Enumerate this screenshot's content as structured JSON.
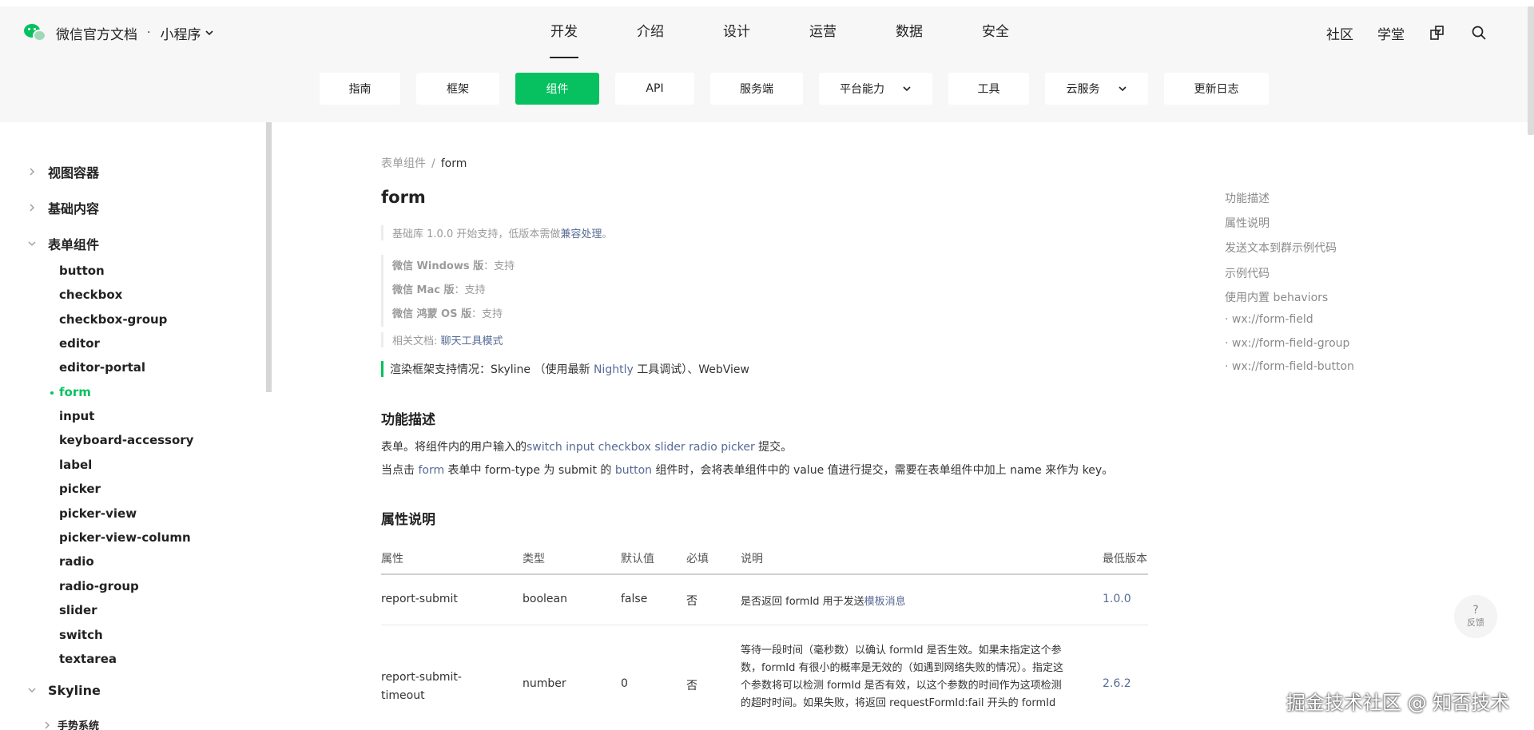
{
  "header": {
    "brand_title": "微信官方文档",
    "brand_separator": "·",
    "brand_sub": "小程序",
    "nav": [
      "开发",
      "介绍",
      "设计",
      "运营",
      "数据",
      "安全"
    ],
    "active_nav": "开发",
    "right_links": [
      "社区",
      "学堂"
    ]
  },
  "subnav": {
    "items": [
      "指南",
      "框架",
      "组件",
      "API",
      "服务端",
      "平台能力",
      "工具",
      "云服务",
      "更新日志"
    ],
    "active": "组件"
  },
  "sidebar": {
    "groups": [
      "视图容器",
      "基础内容",
      "表单组件",
      "Skyline"
    ],
    "items": [
      "button",
      "checkbox",
      "checkbox-group",
      "editor",
      "editor-portal",
      "form",
      "input",
      "keyboard-accessory",
      "label",
      "picker",
      "picker-view",
      "picker-view-column",
      "radio",
      "radio-group",
      "slider",
      "switch",
      "textarea"
    ],
    "active_item": "form",
    "sub_group": "手势系统"
  },
  "main": {
    "breadcrumb": {
      "parent": "表单组件",
      "sep": "/",
      "current": "form"
    },
    "title": "form",
    "support": {
      "prefix": "基础库 1.0.0 开始支持，低版本需做",
      "link": "兼容处理",
      "suffix": "。"
    },
    "platforms": [
      {
        "label": "微信 Windows 版",
        "value": "：支持"
      },
      {
        "label": "微信 Mac 版",
        "value": "：支持"
      },
      {
        "label": "微信 鸿蒙 OS 版",
        "value": "：支持"
      }
    ],
    "related": {
      "prefix": "相关文档: ",
      "link": "聊天工具模式"
    },
    "render": {
      "prefix": "渲染框架支持情况：Skyline （使用最新 ",
      "link": "Nightly",
      "suffix": " 工具调试）、WebView"
    },
    "section1": {
      "title": "功能描述",
      "p1_prefix": "表单。将组件内的用户输入的",
      "p1_link": "switch input checkbox slider radio picker",
      "p1_suffix": " 提交。",
      "p2_a": "当点击 ",
      "p2_link1": "form",
      "p2_b": " 表单中 form-type 为 submit 的 ",
      "p2_link2": "button",
      "p2_c": " 组件时，会将表单组件中的 value 值进行提交，需要在表单组件中加上 name 来作为 key。"
    },
    "section2": {
      "title": "属性说明"
    },
    "table": {
      "headers": [
        "属性",
        "类型",
        "默认值",
        "必填",
        "说明",
        "最低版本"
      ],
      "rows": [
        {
          "name": "report-submit",
          "type": "boolean",
          "default": "false",
          "required": "否",
          "desc_prefix": "是否返回 formId 用于发送",
          "desc_link": "模板消息",
          "version": "1.0.0"
        },
        {
          "name": "report-submit-timeout",
          "type": "number",
          "default": "0",
          "required": "否",
          "desc": "等待一段时间（毫秒数）以确认 formId 是否生效。如果未指定这个参数，formId 有很小的概率是无效的（如遇到网络失败的情况）。指定这个参数将可以检测 formId 是否有效，以这个参数的时间作为这项检测的超时时间。如果失败，将返回 requestFormId:fail 开头的 formId",
          "version": "2.6.2"
        }
      ]
    }
  },
  "toc": [
    "功能描述",
    "属性说明",
    "发送文本到群示例代码",
    "示例代码",
    "使用内置 behaviors",
    "· wx://form-field",
    "· wx://form-field-group",
    "· wx://form-field-button"
  ],
  "feedback": {
    "icon": "?",
    "label": "反馈"
  },
  "watermark": "掘金技术社区 @ 知否技术",
  "colors": {
    "accent": "#07c160",
    "link": "#576b95",
    "header_bg": "#f7f7f7"
  }
}
